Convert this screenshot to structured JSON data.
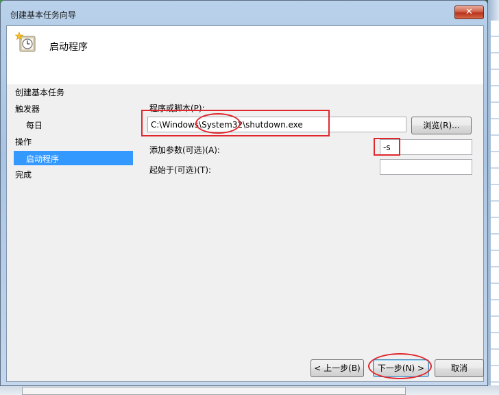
{
  "window": {
    "title": "创建基本任务向导",
    "close_glyph": "✕"
  },
  "header": {
    "title": "启动程序",
    "icon": "task-clock-icon"
  },
  "nav": {
    "items": [
      {
        "label": "创建基本任务"
      },
      {
        "label": "触发器"
      },
      {
        "label": "每日"
      },
      {
        "label": "操作"
      },
      {
        "label": "启动程序",
        "selected": true
      },
      {
        "label": "完成"
      }
    ]
  },
  "form": {
    "program_label": "程序或脚本(P):",
    "program_value": "C:\\Windows\\System32\\shutdown.exe",
    "browse_label": "浏览(R)...",
    "args_label": "添加参数(可选)(A):",
    "args_value": "-s",
    "startin_label": "起始于(可选)(T):",
    "startin_value": ""
  },
  "footer": {
    "back_label": "< 上一步(B)",
    "next_label": "下一步(N) >",
    "cancel_label": "取消"
  },
  "colors": {
    "selection": "#3399ff",
    "annotation": "#e0272c"
  }
}
